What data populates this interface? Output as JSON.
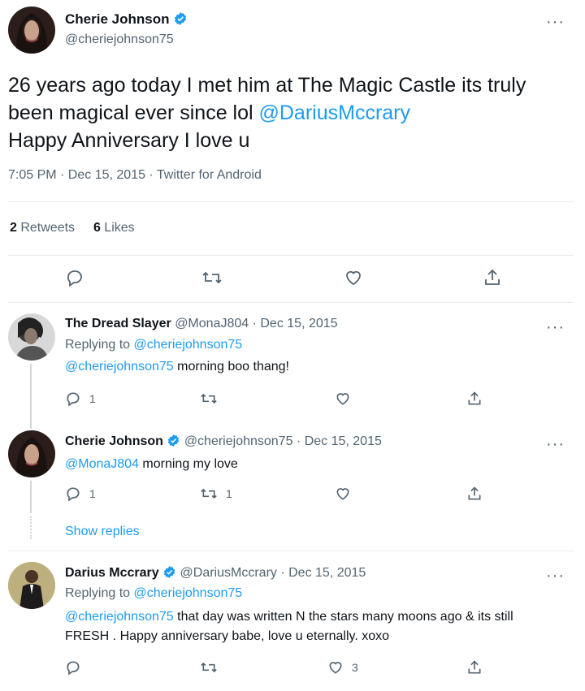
{
  "main_tweet": {
    "author_name": "Cherie Johnson",
    "author_handle": "@cheriejohnson75",
    "text_before_mention": "26 years ago today I met him at The Magic Castle its truly been magical ever since lol ",
    "mention": "@DariusMccrary",
    "text_after_mention": " Happy Anniversary I love u",
    "timestamp": "7:05 PM · Dec 15, 2015 · Twitter for Android",
    "retweets_count": "2",
    "retweets_label": " Retweets",
    "likes_count": "6",
    "likes_label": " Likes"
  },
  "replies": [
    {
      "author_name": "The Dread Slayer",
      "handle_date": "@MonaJ804 · Dec 15, 2015",
      "replying_to_label": "Replying to ",
      "replying_to": "@cheriejohnson75",
      "mention": "@cheriejohnson75",
      "text": " morning boo thang!",
      "reply_count": "1",
      "retweet_count": "",
      "like_count": ""
    },
    {
      "author_name": "Cherie Johnson",
      "handle_date": "@cheriejohnson75 · Dec 15, 2015",
      "mention": "@MonaJ804",
      "text": " morning my love",
      "reply_count": "1",
      "retweet_count": "1",
      "like_count": ""
    },
    {
      "author_name": "Darius Mccrary",
      "handle_date": "@DariusMccrary · Dec 15, 2015",
      "replying_to_label": "Replying to ",
      "replying_to": "@cheriejohnson75",
      "mention": "@cheriejohnson75",
      "text": " that day was written N the stars many moons ago & its still FRESH . Happy anniversary babe, love u eternally. xoxo",
      "reply_count": "",
      "retweet_count": "",
      "like_count": "3"
    }
  ],
  "show_replies_label": "Show replies",
  "more_label": "···",
  "icons": [
    "verified-badge-icon",
    "reply-icon",
    "retweet-icon",
    "like-icon",
    "share-icon",
    "more-icon"
  ],
  "colors": {
    "accent": "#1d9bf0",
    "muted": "#536471",
    "text": "#0f1419",
    "divider": "#e6ecf0"
  }
}
